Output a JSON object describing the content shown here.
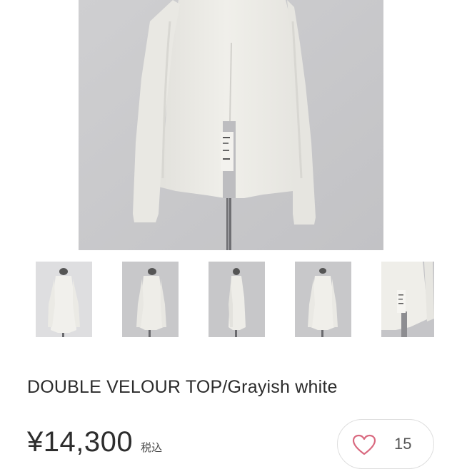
{
  "product": {
    "title": "DOUBLE VELOUR TOP/Grayish white",
    "price": "¥14,300",
    "tax_label": "税込"
  },
  "gallery": {
    "main_image": "product-photo-front",
    "thumbnails": [
      "thumbnail-1",
      "thumbnail-2",
      "thumbnail-3",
      "thumbnail-4",
      "thumbnail-5"
    ]
  },
  "like": {
    "icon": "heart-icon",
    "count": "15",
    "color": "#d9697f"
  },
  "colors": {
    "photo_background": "#c9c9cb",
    "garment": "#ecebe6"
  }
}
